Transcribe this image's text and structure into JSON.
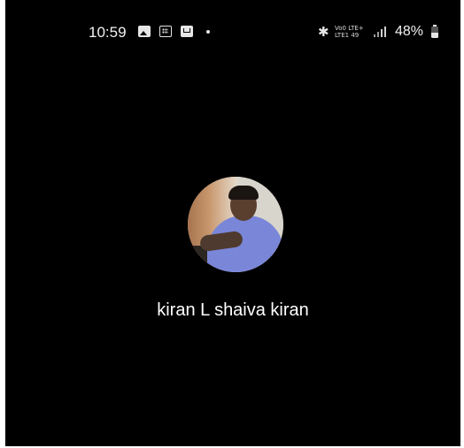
{
  "status_bar": {
    "time": "10:59",
    "notification_icons": [
      "gallery-icon",
      "calculator-icon",
      "mail-icon",
      "dot-icon"
    ],
    "bluetooth_icon": "bluetooth-icon",
    "network_text_line1": "Vo0 LTE+",
    "network_text_line2": "LTE1 49",
    "signal_icon": "signal-icon",
    "battery_percent": "48%",
    "battery_level": 0.48
  },
  "contact": {
    "avatar_icon": "avatar",
    "name": "kiran L shaiva kiran"
  },
  "colors": {
    "background": "#000000",
    "text": "#ffffff"
  }
}
